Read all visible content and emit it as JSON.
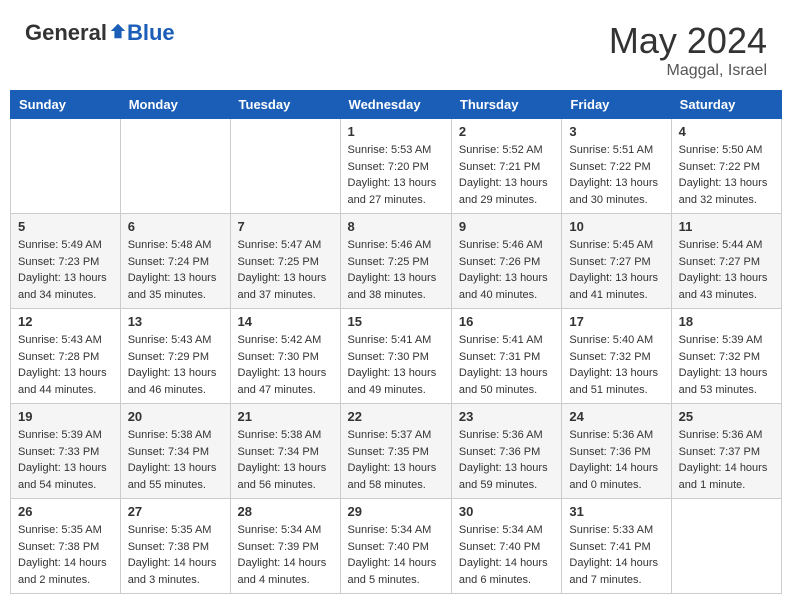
{
  "header": {
    "logo_general": "General",
    "logo_blue": "Blue",
    "month_year": "May 2024",
    "location": "Maggal, Israel"
  },
  "days_of_week": [
    "Sunday",
    "Monday",
    "Tuesday",
    "Wednesday",
    "Thursday",
    "Friday",
    "Saturday"
  ],
  "weeks": [
    {
      "days": [
        {
          "number": "",
          "sunrise": "",
          "sunset": "",
          "daylight": ""
        },
        {
          "number": "",
          "sunrise": "",
          "sunset": "",
          "daylight": ""
        },
        {
          "number": "",
          "sunrise": "",
          "sunset": "",
          "daylight": ""
        },
        {
          "number": "1",
          "sunrise": "Sunrise: 5:53 AM",
          "sunset": "Sunset: 7:20 PM",
          "daylight": "Daylight: 13 hours and 27 minutes."
        },
        {
          "number": "2",
          "sunrise": "Sunrise: 5:52 AM",
          "sunset": "Sunset: 7:21 PM",
          "daylight": "Daylight: 13 hours and 29 minutes."
        },
        {
          "number": "3",
          "sunrise": "Sunrise: 5:51 AM",
          "sunset": "Sunset: 7:22 PM",
          "daylight": "Daylight: 13 hours and 30 minutes."
        },
        {
          "number": "4",
          "sunrise": "Sunrise: 5:50 AM",
          "sunset": "Sunset: 7:22 PM",
          "daylight": "Daylight: 13 hours and 32 minutes."
        }
      ]
    },
    {
      "days": [
        {
          "number": "5",
          "sunrise": "Sunrise: 5:49 AM",
          "sunset": "Sunset: 7:23 PM",
          "daylight": "Daylight: 13 hours and 34 minutes."
        },
        {
          "number": "6",
          "sunrise": "Sunrise: 5:48 AM",
          "sunset": "Sunset: 7:24 PM",
          "daylight": "Daylight: 13 hours and 35 minutes."
        },
        {
          "number": "7",
          "sunrise": "Sunrise: 5:47 AM",
          "sunset": "Sunset: 7:25 PM",
          "daylight": "Daylight: 13 hours and 37 minutes."
        },
        {
          "number": "8",
          "sunrise": "Sunrise: 5:46 AM",
          "sunset": "Sunset: 7:25 PM",
          "daylight": "Daylight: 13 hours and 38 minutes."
        },
        {
          "number": "9",
          "sunrise": "Sunrise: 5:46 AM",
          "sunset": "Sunset: 7:26 PM",
          "daylight": "Daylight: 13 hours and 40 minutes."
        },
        {
          "number": "10",
          "sunrise": "Sunrise: 5:45 AM",
          "sunset": "Sunset: 7:27 PM",
          "daylight": "Daylight: 13 hours and 41 minutes."
        },
        {
          "number": "11",
          "sunrise": "Sunrise: 5:44 AM",
          "sunset": "Sunset: 7:27 PM",
          "daylight": "Daylight: 13 hours and 43 minutes."
        }
      ]
    },
    {
      "days": [
        {
          "number": "12",
          "sunrise": "Sunrise: 5:43 AM",
          "sunset": "Sunset: 7:28 PM",
          "daylight": "Daylight: 13 hours and 44 minutes."
        },
        {
          "number": "13",
          "sunrise": "Sunrise: 5:43 AM",
          "sunset": "Sunset: 7:29 PM",
          "daylight": "Daylight: 13 hours and 46 minutes."
        },
        {
          "number": "14",
          "sunrise": "Sunrise: 5:42 AM",
          "sunset": "Sunset: 7:30 PM",
          "daylight": "Daylight: 13 hours and 47 minutes."
        },
        {
          "number": "15",
          "sunrise": "Sunrise: 5:41 AM",
          "sunset": "Sunset: 7:30 PM",
          "daylight": "Daylight: 13 hours and 49 minutes."
        },
        {
          "number": "16",
          "sunrise": "Sunrise: 5:41 AM",
          "sunset": "Sunset: 7:31 PM",
          "daylight": "Daylight: 13 hours and 50 minutes."
        },
        {
          "number": "17",
          "sunrise": "Sunrise: 5:40 AM",
          "sunset": "Sunset: 7:32 PM",
          "daylight": "Daylight: 13 hours and 51 minutes."
        },
        {
          "number": "18",
          "sunrise": "Sunrise: 5:39 AM",
          "sunset": "Sunset: 7:32 PM",
          "daylight": "Daylight: 13 hours and 53 minutes."
        }
      ]
    },
    {
      "days": [
        {
          "number": "19",
          "sunrise": "Sunrise: 5:39 AM",
          "sunset": "Sunset: 7:33 PM",
          "daylight": "Daylight: 13 hours and 54 minutes."
        },
        {
          "number": "20",
          "sunrise": "Sunrise: 5:38 AM",
          "sunset": "Sunset: 7:34 PM",
          "daylight": "Daylight: 13 hours and 55 minutes."
        },
        {
          "number": "21",
          "sunrise": "Sunrise: 5:38 AM",
          "sunset": "Sunset: 7:34 PM",
          "daylight": "Daylight: 13 hours and 56 minutes."
        },
        {
          "number": "22",
          "sunrise": "Sunrise: 5:37 AM",
          "sunset": "Sunset: 7:35 PM",
          "daylight": "Daylight: 13 hours and 58 minutes."
        },
        {
          "number": "23",
          "sunrise": "Sunrise: 5:36 AM",
          "sunset": "Sunset: 7:36 PM",
          "daylight": "Daylight: 13 hours and 59 minutes."
        },
        {
          "number": "24",
          "sunrise": "Sunrise: 5:36 AM",
          "sunset": "Sunset: 7:36 PM",
          "daylight": "Daylight: 14 hours and 0 minutes."
        },
        {
          "number": "25",
          "sunrise": "Sunrise: 5:36 AM",
          "sunset": "Sunset: 7:37 PM",
          "daylight": "Daylight: 14 hours and 1 minute."
        }
      ]
    },
    {
      "days": [
        {
          "number": "26",
          "sunrise": "Sunrise: 5:35 AM",
          "sunset": "Sunset: 7:38 PM",
          "daylight": "Daylight: 14 hours and 2 minutes."
        },
        {
          "number": "27",
          "sunrise": "Sunrise: 5:35 AM",
          "sunset": "Sunset: 7:38 PM",
          "daylight": "Daylight: 14 hours and 3 minutes."
        },
        {
          "number": "28",
          "sunrise": "Sunrise: 5:34 AM",
          "sunset": "Sunset: 7:39 PM",
          "daylight": "Daylight: 14 hours and 4 minutes."
        },
        {
          "number": "29",
          "sunrise": "Sunrise: 5:34 AM",
          "sunset": "Sunset: 7:40 PM",
          "daylight": "Daylight: 14 hours and 5 minutes."
        },
        {
          "number": "30",
          "sunrise": "Sunrise: 5:34 AM",
          "sunset": "Sunset: 7:40 PM",
          "daylight": "Daylight: 14 hours and 6 minutes."
        },
        {
          "number": "31",
          "sunrise": "Sunrise: 5:33 AM",
          "sunset": "Sunset: 7:41 PM",
          "daylight": "Daylight: 14 hours and 7 minutes."
        },
        {
          "number": "",
          "sunrise": "",
          "sunset": "",
          "daylight": ""
        }
      ]
    }
  ]
}
